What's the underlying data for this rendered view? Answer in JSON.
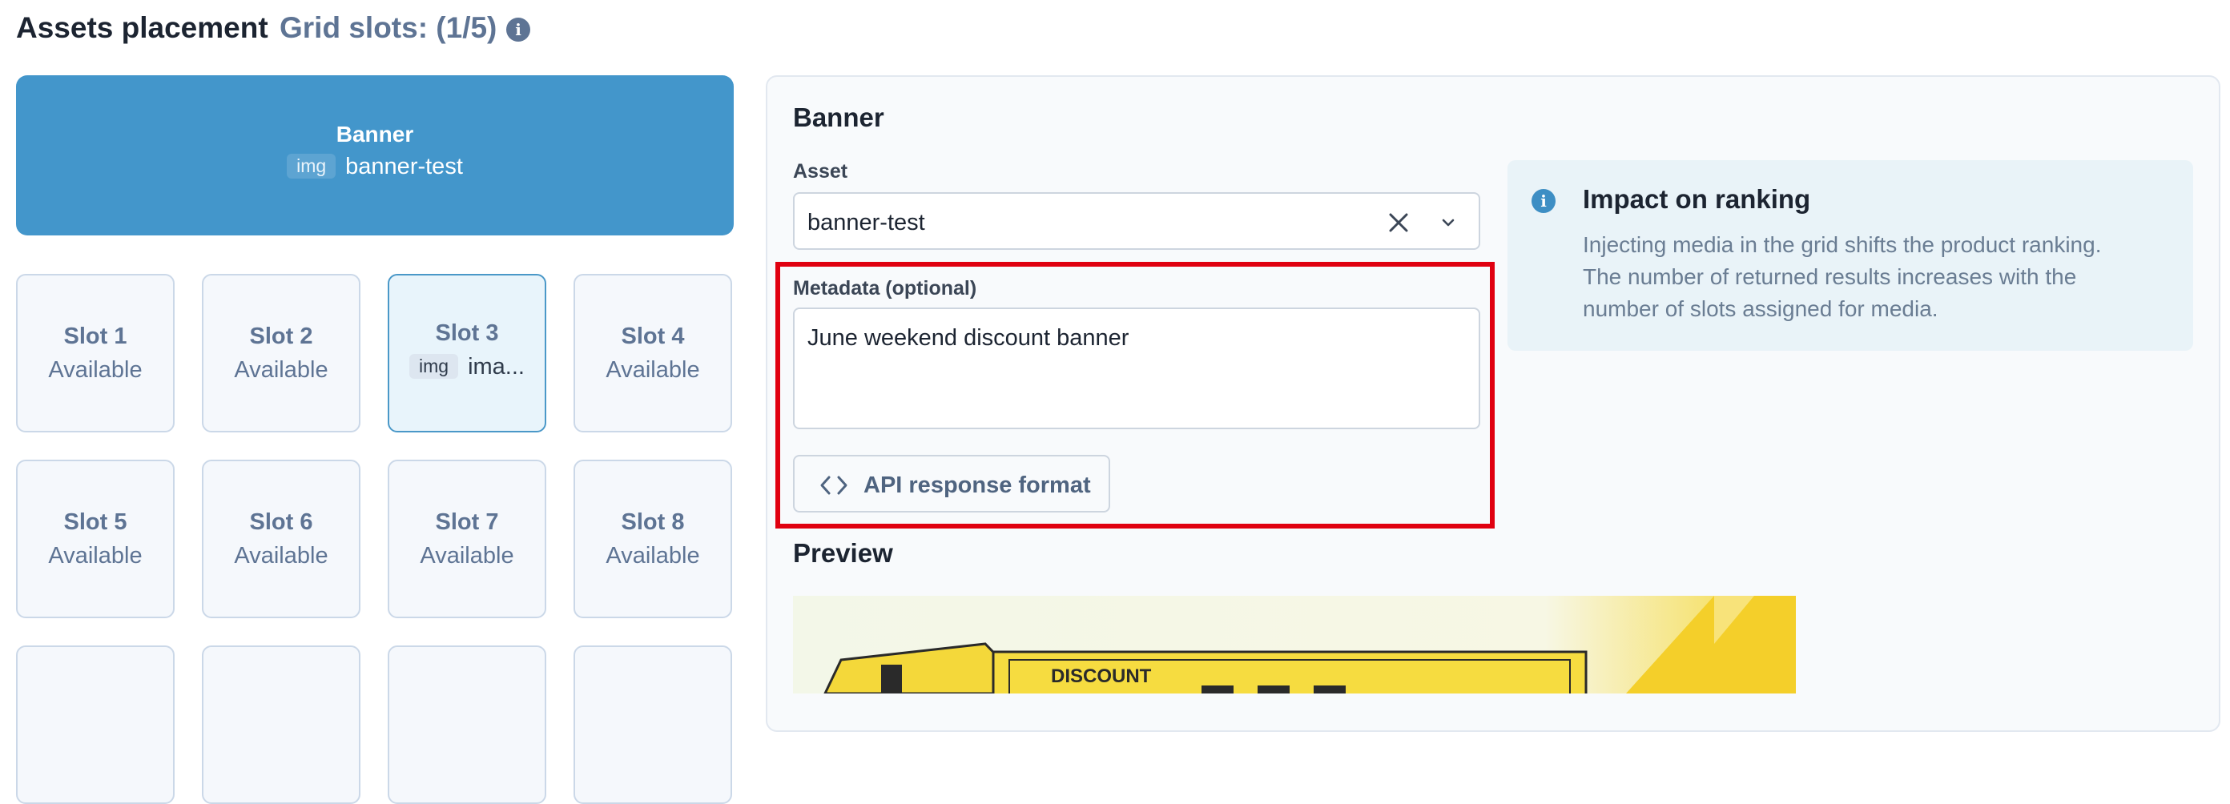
{
  "header": {
    "title": "Assets placement",
    "grid_slots": "Grid slots: (1/5)",
    "info_icon": "info-icon"
  },
  "banner_tile": {
    "label": "Banner",
    "asset_type": "img",
    "asset_name": "banner-test",
    "color": "#4396cb"
  },
  "slots": [
    {
      "name": "Slot 1",
      "status": "Available"
    },
    {
      "name": "Slot 2",
      "status": "Available"
    },
    {
      "name": "Slot 3",
      "asset_type": "img",
      "status": "ima...",
      "selected": true
    },
    {
      "name": "Slot 4",
      "status": "Available"
    },
    {
      "name": "Slot 5",
      "status": "Available"
    },
    {
      "name": "Slot 6",
      "status": "Available"
    },
    {
      "name": "Slot 7",
      "status": "Available"
    },
    {
      "name": "Slot 8",
      "status": "Available"
    }
  ],
  "panel": {
    "title": "Banner",
    "asset_label": "Asset",
    "asset_value": "banner-test",
    "metadata_label": "Metadata (optional)",
    "metadata_value": "June weekend discount banner",
    "api_button_label": "API response format",
    "preview_title": "Preview",
    "preview_text": "DISCOUNT"
  },
  "info_box": {
    "title": "Impact on ranking",
    "body": "Injecting media in the grid shifts the product ranking. The number of returned results increases with the number of slots assigned for media."
  },
  "colors": {
    "accent": "#4396cb",
    "highlight": "#e00010",
    "muted_text": "#5e7494"
  }
}
